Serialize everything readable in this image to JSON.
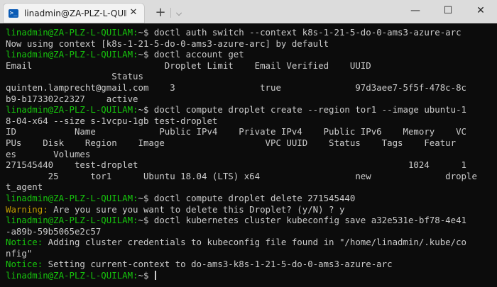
{
  "window": {
    "tab_title": "linadmin@ZA-PLZ-L-QUILAM: -",
    "tab_icon": "terminal-icon",
    "tab_icon_glyph": ">_",
    "close_glyph": "✕",
    "new_tab_glyph": "+",
    "dropdown_glyph": "⌵",
    "minimize_glyph": "—",
    "maximize_glyph": "☐",
    "close_window_glyph": "✕"
  },
  "colors": {
    "background": "#0c0c0c",
    "text": "#cccccc",
    "prompt": "#16c60c",
    "warning": "#c19c00"
  },
  "terminal": {
    "prompt": "linadmin@ZA-PLZ-L-QUILAM:",
    "prompt_suffix": "~$ ",
    "lines": [
      [
        {
          "t": "linadmin@ZA-PLZ-L-QUILAM:",
          "c": "prompt"
        },
        {
          "t": "~$ doctl auth switch --context k8s-1-21-5-do-0-ams3-azure-arc"
        }
      ],
      [
        {
          "t": "Now using context [k8s-1-21-5-do-0-ams3-azure-arc] by default"
        }
      ],
      [
        {
          "t": "linadmin@ZA-PLZ-L-QUILAM:",
          "c": "prompt"
        },
        {
          "t": "~$ doctl account get"
        }
      ],
      [
        {
          "t": "Email                         Droplet Limit    Email Verified    UUID"
        }
      ],
      [
        {
          "t": "                    Status"
        }
      ],
      [
        {
          "t": "quinten.lamprecht@gmail.com    3                true              97d3aee7-5f5f-478c-8c"
        }
      ],
      [
        {
          "t": "b9-b173302c2327    active"
        }
      ],
      [
        {
          "t": "linadmin@ZA-PLZ-L-QUILAM:",
          "c": "prompt"
        },
        {
          "t": "~$ doctl compute droplet create --region tor1 --image ubuntu-1"
        }
      ],
      [
        {
          "t": "8-04-x64 --size s-1vcpu-1gb test-droplet"
        }
      ],
      [
        {
          "t": "ID           Name            Public IPv4    Private IPv4    Public IPv6    Memory    VC"
        }
      ],
      [
        {
          "t": "PUs    Disk    Region    Image                   VPC UUID    Status    Tags    Featur"
        }
      ],
      [
        {
          "t": "es       Volumes"
        }
      ],
      [
        {
          "t": "271545440    test-droplet                                                   1024      1"
        }
      ],
      [
        {
          "t": "        25      tor1      Ubuntu 18.04 (LTS) x64                  new              drople"
        }
      ],
      [
        {
          "t": "t_agent"
        }
      ],
      [
        {
          "t": "linadmin@ZA-PLZ-L-QUILAM:",
          "c": "prompt"
        },
        {
          "t": "~$ doctl compute droplet delete 271545440"
        }
      ],
      [
        {
          "t": "Warning:",
          "c": "warn"
        },
        {
          "t": " Are you sure you want to delete this Droplet? (y/N) ? y"
        }
      ],
      [
        {
          "t": "linadmin@ZA-PLZ-L-QUILAM:",
          "c": "prompt"
        },
        {
          "t": "~$ doctl kubernetes cluster kubeconfig save a32e531e-bf78-4e41"
        }
      ],
      [
        {
          "t": "-a89b-59b5065e2c57"
        }
      ],
      [
        {
          "t": "Notice:",
          "c": "prompt"
        },
        {
          "t": " Adding cluster credentials to kubeconfig file found in \"/home/linadmin/.kube/co"
        }
      ],
      [
        {
          "t": "nfig\""
        }
      ],
      [
        {
          "t": "Notice:",
          "c": "prompt"
        },
        {
          "t": " Setting current-context to do-ams3-k8s-1-21-5-do-0-ams3-azure-arc"
        }
      ]
    ],
    "current_input": ""
  }
}
